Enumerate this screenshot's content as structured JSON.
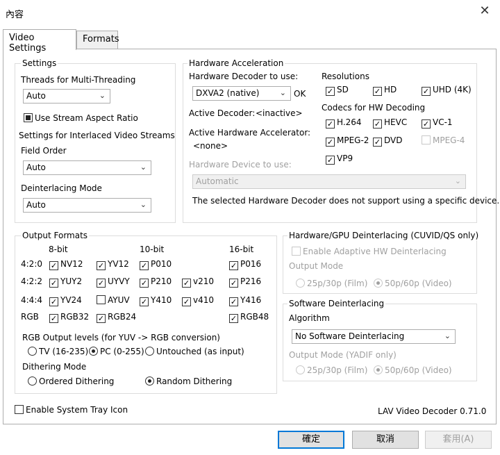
{
  "window": {
    "title": "內容",
    "close": "✕"
  },
  "tabs": [
    {
      "label": "Video Settings"
    },
    {
      "label": "Formats"
    }
  ],
  "settings": {
    "group_title": "Settings",
    "threads_label": "Threads for Multi-Threading",
    "threads_value": "Auto",
    "stream_aspect_label": "Use Stream Aspect Ratio",
    "interlaced_title": "Settings for Interlaced Video Streams",
    "field_order_label": "Field Order",
    "field_order_value": "Auto",
    "deint_mode_label": "Deinterlacing Mode",
    "deint_mode_value": "Auto"
  },
  "hw": {
    "group_title": "Hardware Acceleration",
    "decoder_label": "Hardware Decoder to use:",
    "decoder_value": "DXVA2 (native)",
    "decoder_status": "OK",
    "active_decoder_label": "Active Decoder:",
    "active_decoder_value": "<inactive>",
    "active_accel_label": "Active Hardware Accelerator:",
    "active_accel_value": "<none>",
    "device_label": "Hardware Device to use:",
    "device_value": "Automatic",
    "note": "The selected Hardware Decoder does not support using a specific device.",
    "resolutions_title": "Resolutions",
    "resolutions": [
      "SD",
      "HD",
      "UHD (4K)"
    ],
    "codecs_title": "Codecs for HW Decoding",
    "codecs": [
      "H.264",
      "HEVC",
      "VC-1",
      "MPEG-2",
      "DVD",
      "MPEG-4",
      "VP9"
    ]
  },
  "output": {
    "group_title": "Output Formats",
    "col_8bit": "8-bit",
    "col_10bit": "10-bit",
    "col_16bit": "16-bit",
    "rows": [
      "4:2:0",
      "4:2:2",
      "4:4:4",
      "RGB"
    ],
    "formats": [
      "NV12",
      "YV12",
      "P010",
      "P016",
      "YUY2",
      "UYVY",
      "P210",
      "v210",
      "P216",
      "YV24",
      "AYUV",
      "Y410",
      "v410",
      "Y416",
      "RGB32",
      "RGB24",
      "RGB48"
    ],
    "rgb_levels_label": "RGB Output levels (for YUV -> RGB conversion)",
    "rgb_levels": [
      "TV (16-235)",
      "PC (0-255)",
      "Untouched (as input)"
    ],
    "dither_label": "Dithering Mode",
    "dither_options": [
      "Ordered Dithering",
      "Random Dithering"
    ]
  },
  "gpu_deint": {
    "group_title": "Hardware/GPU Deinterlacing (CUVID/QS only)",
    "enable_label": "Enable Adaptive HW Deinterlacing",
    "output_mode_label": "Output Mode",
    "options": [
      "25p/30p (Film)",
      "50p/60p (Video)"
    ]
  },
  "sw_deint": {
    "group_title": "Software Deinterlacing",
    "algorithm_label": "Algorithm",
    "algorithm_value": "No Software Deinterlacing",
    "output_mode_label": "Output Mode (YADIF only)",
    "options": [
      "25p/30p (Film)",
      "50p/60p (Video)"
    ]
  },
  "tray_label": "Enable System Tray Icon",
  "version": "LAV Video Decoder 0.71.0",
  "buttons": {
    "ok": "確定",
    "cancel": "取消",
    "apply": "套用(A)"
  }
}
